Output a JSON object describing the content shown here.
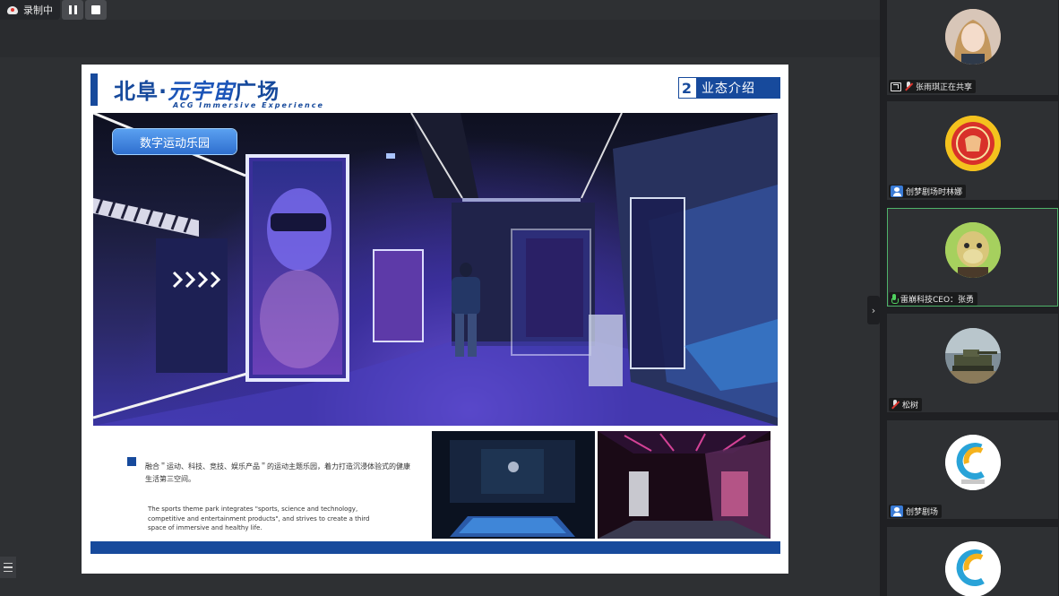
{
  "recording": {
    "status_label": "录制中"
  },
  "slide": {
    "brand_name_a": "北阜·",
    "brand_name_b": "元宇宙",
    "brand_name_c": "广场",
    "brand_subtitle": "ACG Immersive Experience",
    "section_number": "2",
    "section_title": "业态介绍",
    "hero_label": "数字运动乐园",
    "description_cn": "融合＂运动、科技、竞技、娱乐产品＂的运动主题乐园，着力打造沉浸体验式的健康生活第三空间。",
    "description_en": "The sports theme park integrates \"sports, science and technology, competitive and entertainment products\", and strives to create a third space of immersive and healthy life."
  },
  "participants": [
    {
      "name": "张雨琪正在共享",
      "status_icon": "screen-share-icon",
      "avatar": "woman-portrait"
    },
    {
      "name": "创梦剧场时林娜",
      "status_icon": "user-icon",
      "avatar": "red-badge-logo"
    },
    {
      "name": "雷崩科技CEO：张勇",
      "status_icon": "mic-on-icon",
      "avatar": "ape-cartoon",
      "active": true
    },
    {
      "name": "松树",
      "status_icon": "mic-off-icon",
      "avatar": "tank-photo"
    },
    {
      "name": "创梦剧场",
      "status_icon": "user-icon",
      "avatar": "cm-logo"
    },
    {
      "name": "",
      "status_icon": "",
      "avatar": "cm-logo"
    }
  ],
  "colors": {
    "brand_blue": "#174a9c",
    "active_border": "#4fb36a",
    "recording_red": "#e0352e"
  }
}
